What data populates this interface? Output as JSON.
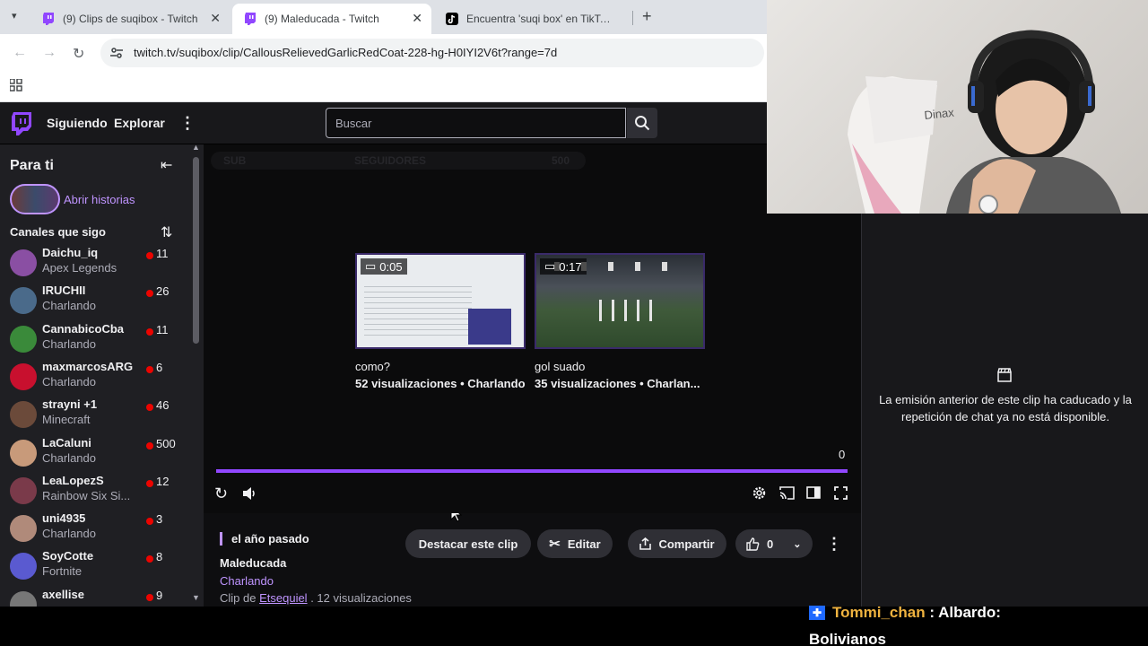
{
  "browser": {
    "tabs": [
      {
        "title": "(9) Clips de suqibox - Twitch",
        "close": "✕"
      },
      {
        "title": "(9) Maleducada - Twitch",
        "close": "✕"
      },
      {
        "title": "Encuentra 'suqi box' en TikTok |",
        "close": ""
      }
    ],
    "new_tab": "+",
    "url": "twitch.tv/suqibox/clip/CallousRelievedGarlicRedCoat-228-hg-H0IYI2V6t?range=7d"
  },
  "twitch_nav": {
    "following": "Siguiendo",
    "explore": "Explorar",
    "more": "⋮",
    "search_placeholder": "Buscar"
  },
  "sidebar": {
    "heading": "Para ti",
    "stories_label": "Abrir historias",
    "channels_heading": "Canales que sigo",
    "channels": [
      {
        "name": "Daichu_iq",
        "game": "Apex Legends",
        "viewers": "11",
        "color": "#8a4fa3"
      },
      {
        "name": "IRUCHII",
        "game": "Charlando",
        "viewers": "26",
        "color": "#4a6a8a"
      },
      {
        "name": "CannabicoCba",
        "game": "Charlando",
        "viewers": "11",
        "color": "#3a8a3a"
      },
      {
        "name": "maxmarcosARG",
        "game": "Charlando",
        "viewers": "6",
        "color": "#c8102e"
      },
      {
        "name": "strayni +1",
        "game": "Minecraft",
        "viewers": "46",
        "color": "#6b4a3a"
      },
      {
        "name": "LaCaluni",
        "game": "Charlando",
        "viewers": "500",
        "color": "#c89a7a"
      },
      {
        "name": "LeaLopezS",
        "game": "Rainbow Six Si...",
        "viewers": "12",
        "color": "#7a3a4a"
      },
      {
        "name": "uni4935",
        "game": "Charlando",
        "viewers": "3",
        "color": "#b08a7a"
      },
      {
        "name": "SoyCotte",
        "game": "Fortnite",
        "viewers": "8",
        "color": "#5a5ad0"
      },
      {
        "name": "axellise",
        "game": "",
        "viewers": "9",
        "color": "#777777"
      }
    ]
  },
  "player": {
    "ghost_left": "SUB",
    "ghost_mid": "SEGUIDORES",
    "ghost_right": "500",
    "timer": "0",
    "progress": 1.0,
    "recommended": [
      {
        "duration": "0:05",
        "title": "como?",
        "meta": "52 visualizaciones • Charlando"
      },
      {
        "duration": "0:17",
        "title": "gol suado",
        "meta": "35 visualizaciones • Charlan..."
      }
    ]
  },
  "clip_info": {
    "when": "el año pasado",
    "title": "Maleducada",
    "category": "Charlando",
    "by_prefix": "Clip de",
    "author": "Etsequiel",
    "views": ". 12 visualizaciones",
    "buttons": {
      "highlight": "Destacar este clip",
      "edit": "Editar",
      "share": "Compartir",
      "likes": "0"
    }
  },
  "chat": {
    "message": "La emisión anterior de este clip ha caducado y la repetición de chat ya no está disponible."
  },
  "overlay_chat": {
    "user": "Tommi_chan",
    "sep": " : ",
    "text1": "Albardo:",
    "text2": "Bolivianos"
  },
  "colors": {
    "twitch_purple": "#9147ff",
    "link_purple": "#bf94ff",
    "live_red": "#eb0400"
  }
}
